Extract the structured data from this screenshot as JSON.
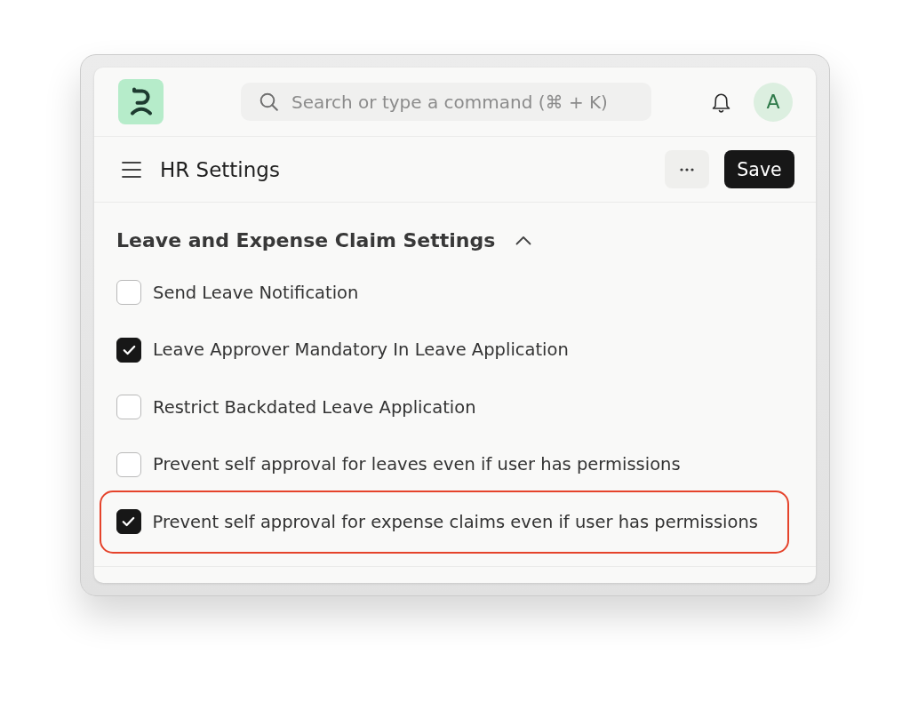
{
  "navbar": {
    "search": {
      "placeholder": "Search or type a command (⌘ + K)"
    },
    "avatar": {
      "initial": "A"
    }
  },
  "page_head": {
    "title": "HR Settings",
    "save_button": "Save"
  },
  "section": {
    "title": "Leave and Expense Claim Settings",
    "expanded": true,
    "settings": [
      {
        "label": "Send Leave Notification",
        "checked": false,
        "highlighted": false
      },
      {
        "label": "Leave Approver Mandatory In Leave Application",
        "checked": true,
        "highlighted": false
      },
      {
        "label": "Restrict Backdated Leave Application",
        "checked": false,
        "highlighted": false
      },
      {
        "label": "Prevent self approval for leaves even if user has permissions",
        "checked": false,
        "highlighted": false
      },
      {
        "label": "Prevent self approval for expense claims even if user has permissions",
        "checked": true,
        "highlighted": true
      }
    ]
  }
}
